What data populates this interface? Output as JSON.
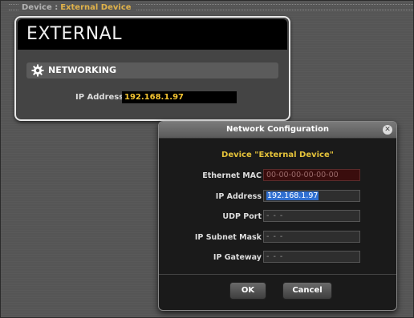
{
  "header": {
    "label": "Device :",
    "value": "External Device"
  },
  "device_panel": {
    "title": "EXTERNAL",
    "section": {
      "icon": "gear-icon",
      "label": "NETWORKING"
    },
    "ip_label": "IP Address",
    "ip_value": "192.168.1.97"
  },
  "dialog": {
    "title": "Network Configuration",
    "close_icon": "close-icon",
    "device_line": "Device \"External Device\"",
    "fields": {
      "mac": {
        "label": "Ethernet MAC",
        "value": "00-00-00-00-00-00"
      },
      "ip": {
        "label": "IP Address",
        "value": "192.168.1.97"
      },
      "udp": {
        "label": "UDP Port",
        "value": "- - -"
      },
      "subnet": {
        "label": "IP Subnet Mask",
        "value": "- - -"
      },
      "gateway": {
        "label": "IP Gateway",
        "value": "- - -"
      }
    },
    "ok_label": "OK",
    "cancel_label": "Cancel"
  },
  "colors": {
    "accent_yellow": "#f4c431",
    "selection_blue": "#2f6fd1",
    "mac_bg": "#3a0d0d"
  }
}
